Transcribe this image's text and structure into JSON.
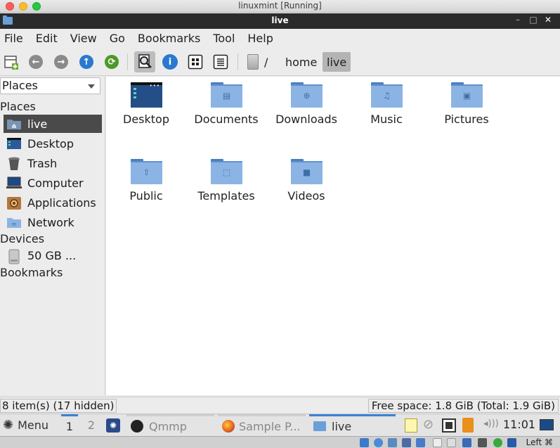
{
  "host": {
    "title": "linuxmint [Running]"
  },
  "window": {
    "title": "live",
    "ctrl_minimize": "–",
    "ctrl_maximize": "□",
    "ctrl_close": "✕"
  },
  "menubar": {
    "items": [
      "File",
      "Edit",
      "View",
      "Go",
      "Bookmarks",
      "Tool",
      "Help"
    ]
  },
  "toolbar": {
    "breadcrumb": {
      "root": "/",
      "home": "home",
      "current": "live"
    }
  },
  "sidebar": {
    "dropdown_value": "Places",
    "sections": {
      "places": "Places",
      "devices": "Devices",
      "bookmarks": "Bookmarks"
    },
    "items": [
      "live",
      "Desktop",
      "Trash",
      "Computer",
      "Applications",
      "Network"
    ],
    "device_items": [
      "50 GB ..."
    ]
  },
  "files": [
    {
      "name": "Desktop",
      "icon": "desktop-icon"
    },
    {
      "name": "Documents",
      "icon": "documents-folder-icon"
    },
    {
      "name": "Downloads",
      "icon": "downloads-folder-icon"
    },
    {
      "name": "Music",
      "icon": "music-folder-icon"
    },
    {
      "name": "Pictures",
      "icon": "pictures-folder-icon"
    },
    {
      "name": "Public",
      "icon": "public-folder-icon"
    },
    {
      "name": "Templates",
      "icon": "templates-folder-icon"
    },
    {
      "name": "Videos",
      "icon": "videos-folder-icon"
    }
  ],
  "status": {
    "items": "8 item(s) (17 hidden)",
    "free_space": "Free space: 1.8 GiB (Total: 1.9 GiB)"
  },
  "taskbar": {
    "menu_label": "Menu",
    "workspaces": [
      "1",
      "2"
    ],
    "tasks": [
      "Qmmp",
      "Sample P...",
      "live"
    ],
    "clock": "11:01"
  },
  "vbox": {
    "host_key": "Left ⌘"
  },
  "colors": {
    "accent": "#3c82d8",
    "selection": "#4a4a4a",
    "folder": "#8bb4e4"
  }
}
